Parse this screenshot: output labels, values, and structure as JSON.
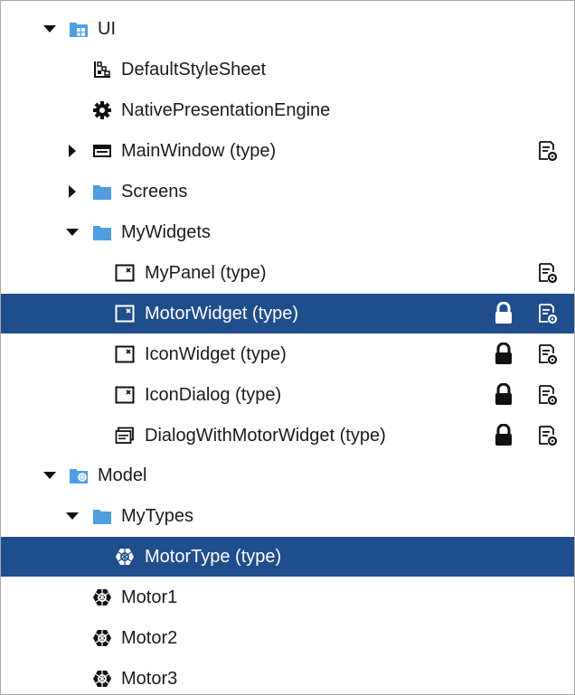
{
  "tree": {
    "rows": [
      {
        "label": "UI",
        "icon": "ui-folder-icon",
        "expander": "expanded"
      },
      {
        "label": "DefaultStyleSheet",
        "icon": "stylesheet-icon"
      },
      {
        "label": "NativePresentationEngine",
        "icon": "gear-icon"
      },
      {
        "label": "MainWindow (type)",
        "icon": "window-icon",
        "expander": "collapsed",
        "properties": true
      },
      {
        "label": "Screens",
        "icon": "folder-icon",
        "expander": "collapsed"
      },
      {
        "label": "MyWidgets",
        "icon": "folder-icon",
        "expander": "expanded"
      },
      {
        "label": "MyPanel (type)",
        "icon": "widget-icon",
        "properties": true
      },
      {
        "label": "MotorWidget (type)",
        "icon": "widget-icon",
        "locked": true,
        "properties": true,
        "selected": true
      },
      {
        "label": "IconWidget (type)",
        "icon": "widget-icon",
        "locked": true,
        "properties": true
      },
      {
        "label": "IconDialog (type)",
        "icon": "widget-icon",
        "locked": true,
        "properties": true
      },
      {
        "label": "DialogWithMotorWidget (type)",
        "icon": "dialog-icon",
        "locked": true,
        "properties": true
      },
      {
        "label": "Model",
        "icon": "model-folder-icon",
        "expander": "expanded"
      },
      {
        "label": "MyTypes",
        "icon": "folder-icon",
        "expander": "expanded"
      },
      {
        "label": "MotorType (type)",
        "icon": "object-type-icon",
        "selected": true
      },
      {
        "label": "Motor1",
        "icon": "object-icon"
      },
      {
        "label": "Motor2",
        "icon": "object-icon"
      },
      {
        "label": "Motor3",
        "icon": "object-icon"
      }
    ]
  },
  "colors": {
    "selection": "#1f4e8c",
    "folder": "#4f9fe0"
  }
}
